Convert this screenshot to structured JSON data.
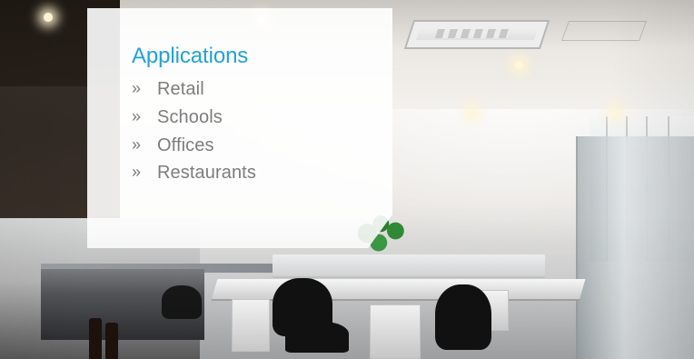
{
  "applications": {
    "heading": "Applications",
    "marker": "»",
    "items": [
      "Retail",
      "Schools",
      "Offices",
      "Restaurants"
    ]
  },
  "colors": {
    "heading": "#1FA2DE",
    "list_text": "#7D7D7D",
    "panel": "#FFFFFF"
  }
}
